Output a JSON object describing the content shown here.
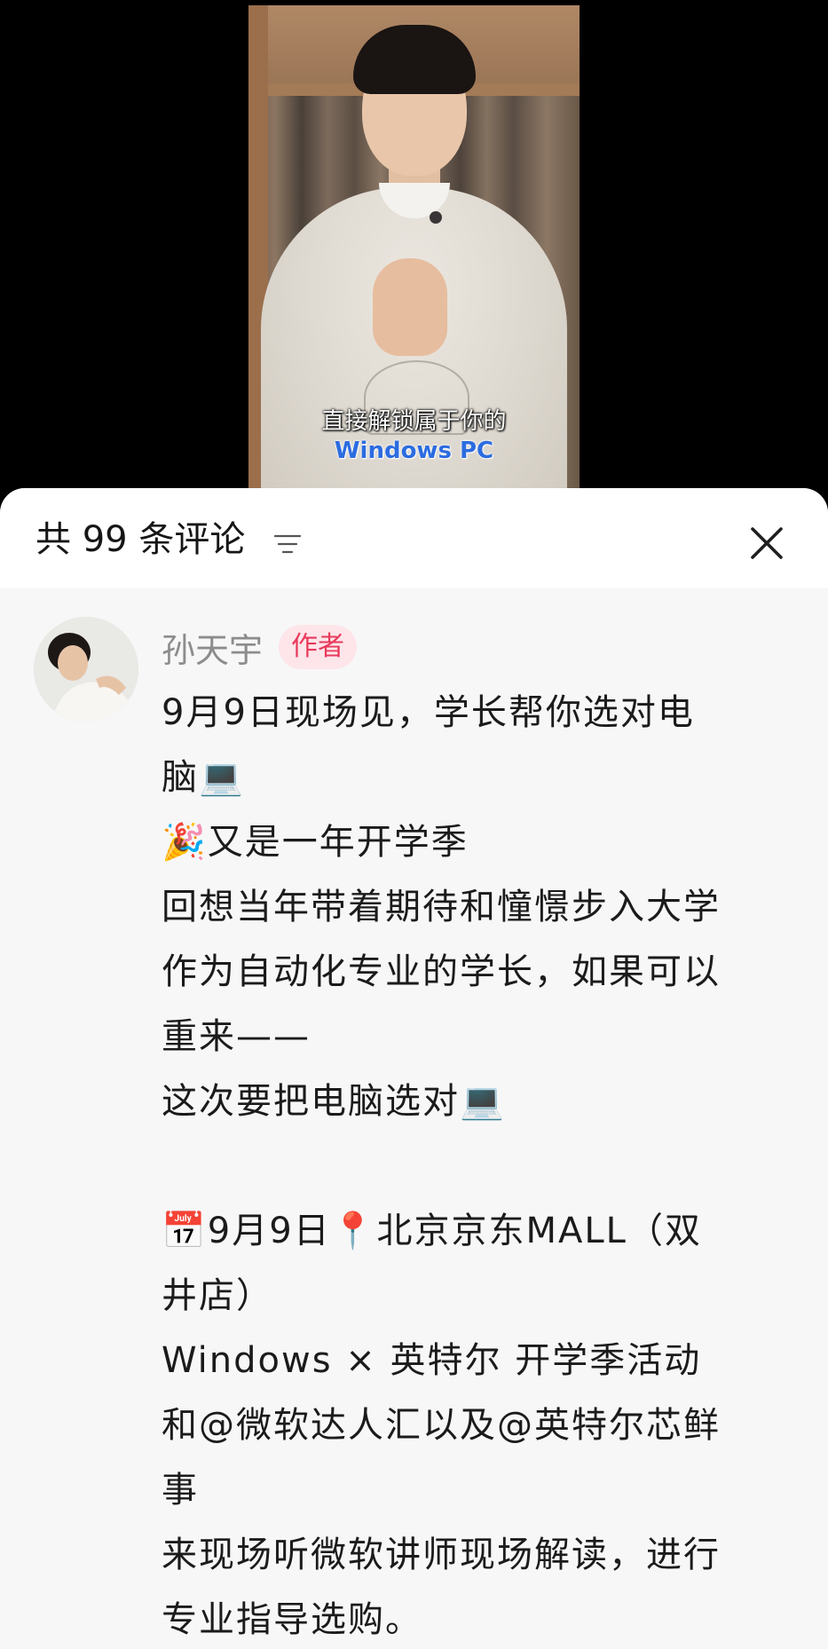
{
  "video": {
    "subtitle_line1": "直接解锁属于你的",
    "subtitle_line2": "Windows PC"
  },
  "comments_panel": {
    "title": "共 99 条评论",
    "sort_icon": "sort-lines-icon",
    "close_icon": "close-icon"
  },
  "comment": {
    "author": "孙天宇",
    "badge": "作者",
    "lines": [
      "9月9日现场见，学长帮你选对电",
      "脑💻",
      "🎉又是一年开学季",
      "回想当年带着期待和憧憬步入大学",
      "作为自动化专业的学长，如果可以",
      "重来——",
      "这次要把电脑选对💻",
      "",
      "📅9月9日📍北京京东MALL（双",
      "井店）",
      "Windows × 英特尔 开学季活动",
      "和@微软达人汇以及@英特尔芯鲜",
      "事",
      "来现场听微软讲师现场解读，进行",
      "专业指导选购。"
    ]
  },
  "colors": {
    "accent": "#e8395b",
    "badge_bg": "#fde5ea",
    "subtitle_blue": "#2c6ce0"
  }
}
